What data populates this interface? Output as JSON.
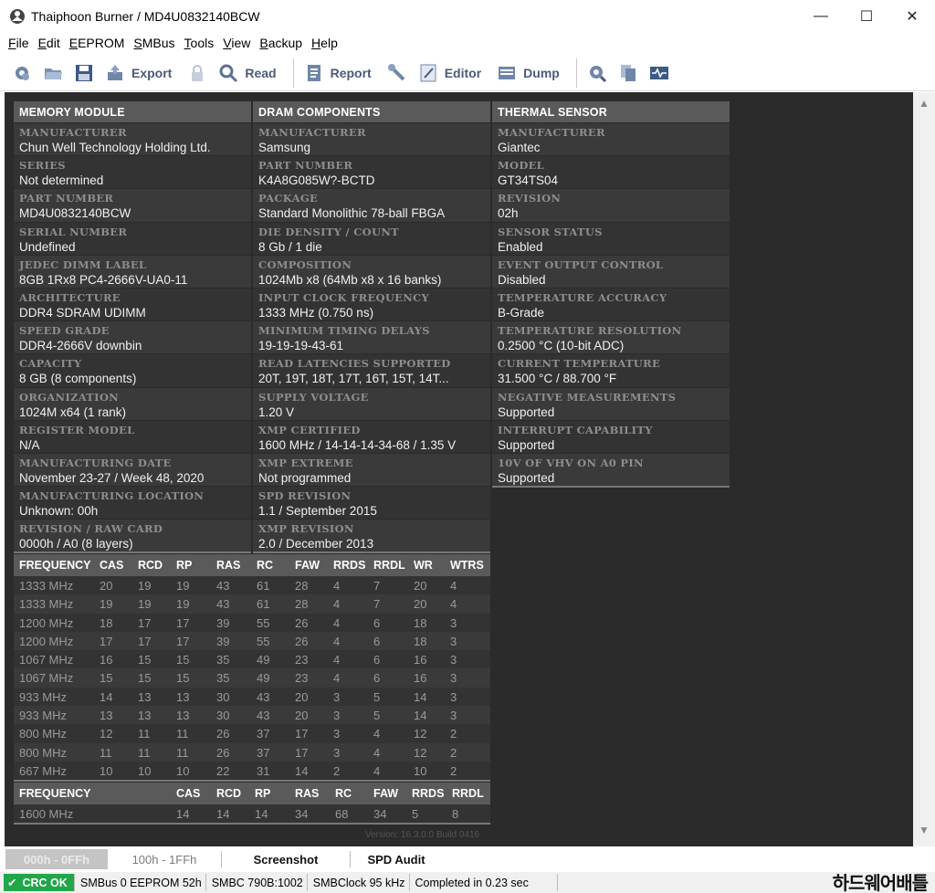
{
  "window": {
    "title": "Thaiphoon Burner / MD4U0832140BCW",
    "minimize": "—",
    "maximize": "☐",
    "close": "✕"
  },
  "menu": [
    "File",
    "Edit",
    "EEPROM",
    "SMBus",
    "Tools",
    "View",
    "Backup",
    "Help"
  ],
  "toolbar": {
    "export": "Export",
    "read": "Read",
    "report": "Report",
    "editor": "Editor",
    "dump": "Dump"
  },
  "memory_module": {
    "header": "MEMORY MODULE",
    "fields": [
      {
        "label": "MANUFACTURER",
        "value": "Chun Well Technology Holding Ltd."
      },
      {
        "label": "SERIES",
        "value": "Not determined"
      },
      {
        "label": "PART NUMBER",
        "value": "MD4U0832140BCW"
      },
      {
        "label": "SERIAL NUMBER",
        "value": "Undefined"
      },
      {
        "label": "JEDEC DIMM LABEL",
        "value": "8GB 1Rx8 PC4-2666V-UA0-11"
      },
      {
        "label": "ARCHITECTURE",
        "value": "DDR4 SDRAM UDIMM"
      },
      {
        "label": "SPEED GRADE",
        "value": "DDR4-2666V downbin"
      },
      {
        "label": "CAPACITY",
        "value": "8 GB (8 components)"
      },
      {
        "label": "ORGANIZATION",
        "value": "1024M x64 (1 rank)"
      },
      {
        "label": "REGISTER MODEL",
        "value": "N/A"
      },
      {
        "label": "MANUFACTURING DATE",
        "value": "November 23-27 / Week 48, 2020"
      },
      {
        "label": "MANUFACTURING LOCATION",
        "value": "Unknown: 00h"
      },
      {
        "label": "REVISION / RAW CARD",
        "value": "0000h / A0 (8 layers)"
      }
    ]
  },
  "dram_components": {
    "header": "DRAM COMPONENTS",
    "fields": [
      {
        "label": "MANUFACTURER",
        "value": "Samsung"
      },
      {
        "label": "PART NUMBER",
        "value": "K4A8G085W?-BCTD"
      },
      {
        "label": "PACKAGE",
        "value": "Standard Monolithic 78-ball FBGA"
      },
      {
        "label": "DIE DENSITY / COUNT",
        "value": "8 Gb / 1 die"
      },
      {
        "label": "COMPOSITION",
        "value": "1024Mb x8 (64Mb x8 x 16 banks)"
      },
      {
        "label": "INPUT CLOCK FREQUENCY",
        "value": "1333 MHz (0.750 ns)"
      },
      {
        "label": "MINIMUM TIMING DELAYS",
        "value": "19-19-19-43-61"
      },
      {
        "label": "READ LATENCIES SUPPORTED",
        "value": "20T, 19T, 18T, 17T, 16T, 15T, 14T..."
      },
      {
        "label": "SUPPLY VOLTAGE",
        "value": "1.20 V"
      },
      {
        "label": "XMP CERTIFIED",
        "value": "1600 MHz / 14-14-14-34-68 / 1.35 V"
      },
      {
        "label": "XMP EXTREME",
        "value": "Not programmed"
      },
      {
        "label": "SPD REVISION",
        "value": "1.1 / September 2015"
      },
      {
        "label": "XMP REVISION",
        "value": "2.0 / December 2013"
      }
    ]
  },
  "thermal_sensor": {
    "header": "THERMAL SENSOR",
    "fields": [
      {
        "label": "MANUFACTURER",
        "value": "Giantec"
      },
      {
        "label": "MODEL",
        "value": "GT34TS04"
      },
      {
        "label": "REVISION",
        "value": "02h"
      },
      {
        "label": "SENSOR STATUS",
        "value": "Enabled"
      },
      {
        "label": "EVENT OUTPUT CONTROL",
        "value": "Disabled"
      },
      {
        "label": "TEMPERATURE ACCURACY",
        "value": "B-Grade"
      },
      {
        "label": "TEMPERATURE RESOLUTION",
        "value": "0.2500 °C (10-bit ADC)"
      },
      {
        "label": "CURRENT TEMPERATURE",
        "value": "31.500 °C / 88.700 °F"
      },
      {
        "label": "NEGATIVE MEASUREMENTS",
        "value": "Supported"
      },
      {
        "label": "INTERRUPT CAPABILITY",
        "value": "Supported"
      },
      {
        "label": "10V OF VHV ON A0 PIN",
        "value": "Supported"
      }
    ]
  },
  "jedec_timings": {
    "columns": [
      "FREQUENCY",
      "CAS",
      "RCD",
      "RP",
      "RAS",
      "RC",
      "FAW",
      "RRDS",
      "RRDL",
      "WR",
      "WTRS"
    ],
    "rows": [
      [
        "1333 MHz",
        "20",
        "19",
        "19",
        "43",
        "61",
        "28",
        "4",
        "7",
        "20",
        "4"
      ],
      [
        "1333 MHz",
        "19",
        "19",
        "19",
        "43",
        "61",
        "28",
        "4",
        "7",
        "20",
        "4"
      ],
      [
        "1200 MHz",
        "18",
        "17",
        "17",
        "39",
        "55",
        "26",
        "4",
        "6",
        "18",
        "3"
      ],
      [
        "1200 MHz",
        "17",
        "17",
        "17",
        "39",
        "55",
        "26",
        "4",
        "6",
        "18",
        "3"
      ],
      [
        "1067 MHz",
        "16",
        "15",
        "15",
        "35",
        "49",
        "23",
        "4",
        "6",
        "16",
        "3"
      ],
      [
        "1067 MHz",
        "15",
        "15",
        "15",
        "35",
        "49",
        "23",
        "4",
        "6",
        "16",
        "3"
      ],
      [
        "933 MHz",
        "14",
        "13",
        "13",
        "30",
        "43",
        "20",
        "3",
        "5",
        "14",
        "3"
      ],
      [
        "933 MHz",
        "13",
        "13",
        "13",
        "30",
        "43",
        "20",
        "3",
        "5",
        "14",
        "3"
      ],
      [
        "800 MHz",
        "12",
        "11",
        "11",
        "26",
        "37",
        "17",
        "3",
        "4",
        "12",
        "2"
      ],
      [
        "800 MHz",
        "11",
        "11",
        "11",
        "26",
        "37",
        "17",
        "3",
        "4",
        "12",
        "2"
      ],
      [
        "667 MHz",
        "10",
        "10",
        "10",
        "22",
        "31",
        "14",
        "2",
        "4",
        "10",
        "2"
      ]
    ]
  },
  "xmp_timings": {
    "columns": [
      "FREQUENCY",
      "CAS",
      "RCD",
      "RP",
      "RAS",
      "RC",
      "FAW",
      "RRDS",
      "RRDL"
    ],
    "rows": [
      [
        "1600 MHz",
        "14",
        "14",
        "14",
        "34",
        "68",
        "34",
        "5",
        "8"
      ]
    ]
  },
  "version": "Version: 16.3.0.0 Build 0416",
  "tabs": [
    "000h - 0FFh",
    "100h - 1FFh",
    "Screenshot",
    "SPD Audit"
  ],
  "status": {
    "crc": "CRC OK",
    "smbus": "SMBus 0 EEPROM 52h",
    "smbc": "SMBC 790B:1002",
    "clock": "SMBClock 95 kHz",
    "completed": "Completed in 0.23 sec"
  },
  "watermark": "하드웨어배틀"
}
